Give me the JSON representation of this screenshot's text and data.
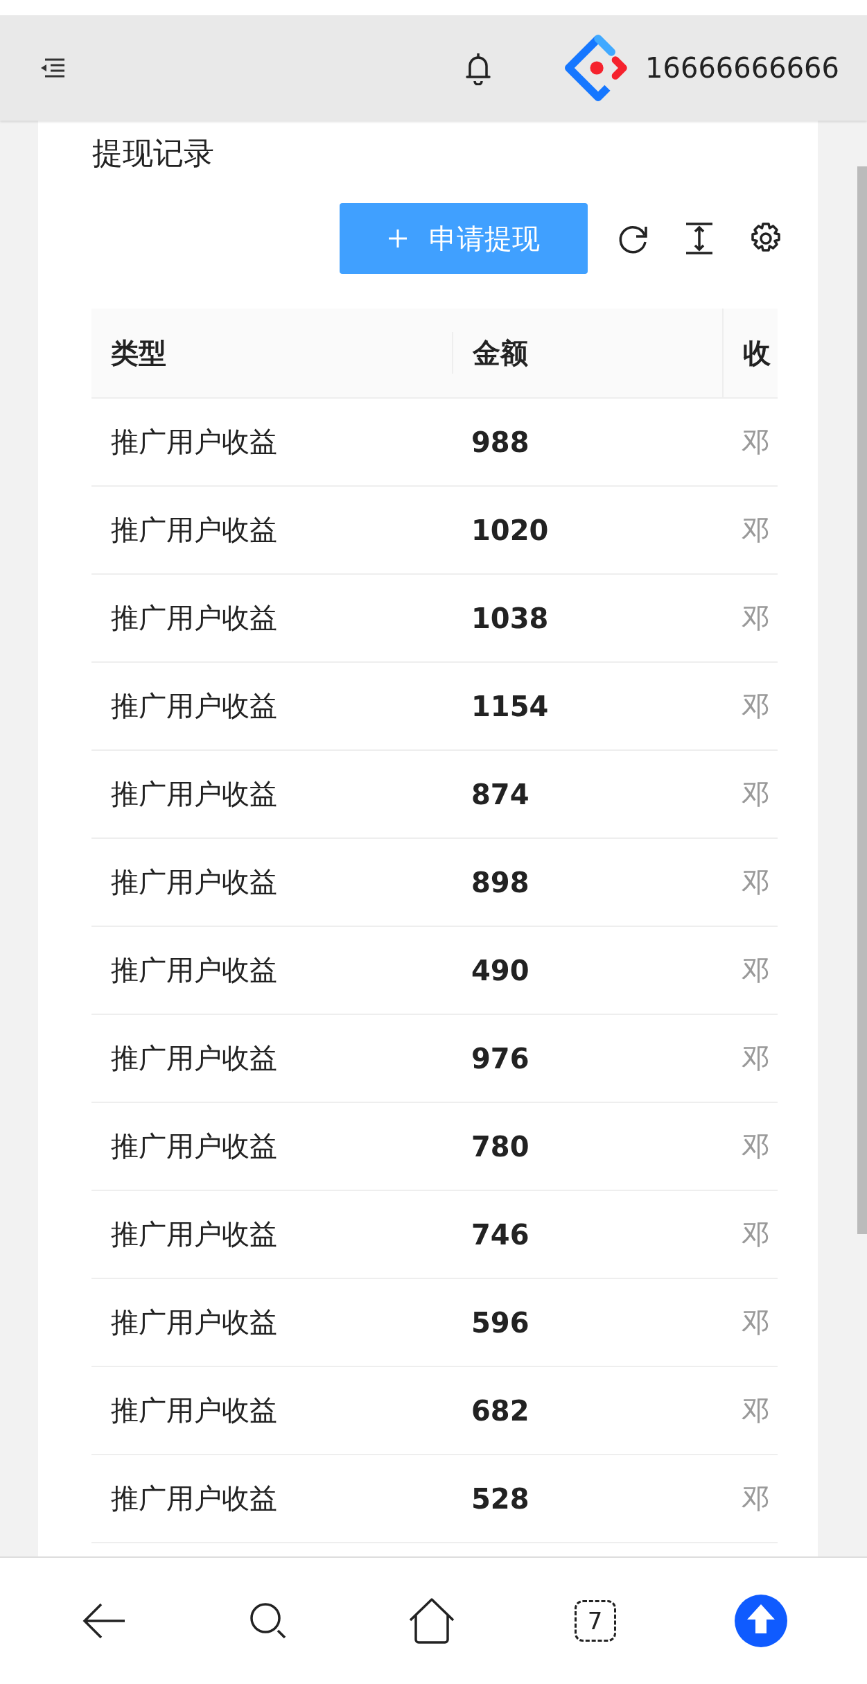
{
  "header": {
    "user": "16666666666"
  },
  "page": {
    "title": "提现记录",
    "primary_button": "申请提现"
  },
  "table": {
    "columns": [
      "类型",
      "金额",
      "收"
    ],
    "rows": [
      {
        "type": "推广用户收益",
        "amount": "988",
        "column_3": "邓"
      },
      {
        "type": "推广用户收益",
        "amount": "1020",
        "column_3": "邓"
      },
      {
        "type": "推广用户收益",
        "amount": "1038",
        "column_3": "邓"
      },
      {
        "type": "推广用户收益",
        "amount": "1154",
        "column_3": "邓"
      },
      {
        "type": "推广用户收益",
        "amount": "874",
        "column_3": "邓"
      },
      {
        "type": "推广用户收益",
        "amount": "898",
        "column_3": "邓"
      },
      {
        "type": "推广用户收益",
        "amount": "490",
        "column_3": "邓"
      },
      {
        "type": "推广用户收益",
        "amount": "976",
        "column_3": "邓"
      },
      {
        "type": "推广用户收益",
        "amount": "780",
        "column_3": "邓"
      },
      {
        "type": "推广用户收益",
        "amount": "746",
        "column_3": "邓"
      },
      {
        "type": "推广用户收益",
        "amount": "596",
        "column_3": "邓"
      },
      {
        "type": "推广用户收益",
        "amount": "682",
        "column_3": "邓"
      },
      {
        "type": "推广用户收益",
        "amount": "528",
        "column_3": "邓"
      }
    ]
  },
  "bottom_nav": {
    "tab_count": "7"
  }
}
